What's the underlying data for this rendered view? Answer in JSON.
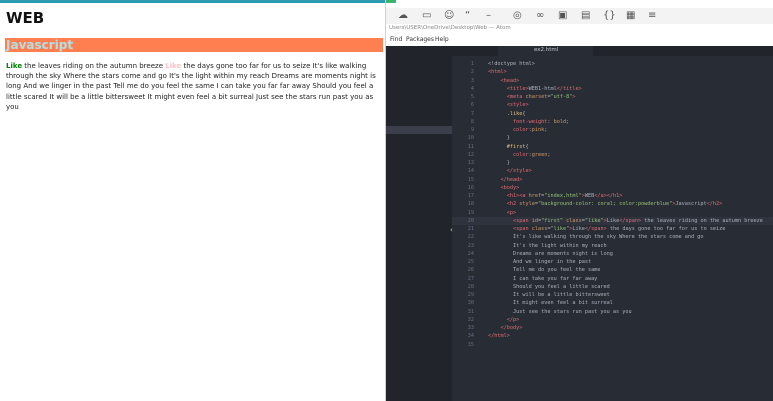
{
  "browser": {
    "h1": "WEB",
    "h2": "Javascript",
    "paragraph": {
      "first_like": "Like",
      "text1": " the leaves riding on the autumn breeze ",
      "second_like": "Like",
      "text2": " the days gone too far for us to seize It's like walking through the sky Where the stars come and go It's the light within my reach Dreams are moments night is long And we linger in the past Tell me do you feel the same I can take you far far away Should you feel a little scared It will be a little bittersweet It might even feel a bit surreal Just see the stars run past you as you"
    }
  },
  "toolbar": {
    "icons": [
      "cloud-icon",
      "video-icon",
      "emoji-icon",
      "quote-icon",
      "font-size-icon",
      "location-icon",
      "link-icon",
      "media-icon",
      "file-icon",
      "braces-icon",
      "table-icon",
      "list-icon"
    ]
  },
  "window": {
    "title_path": "Users\\USER\\OneDrive\\Desktop\\Web — Atom",
    "menu": [
      "Find",
      "Packages",
      "Help"
    ],
    "tab": "ex2.html"
  },
  "editor": {
    "lines": [
      {
        "n": "1",
        "html": "<span class='txt'>&lt;!doctype html&gt;</span>"
      },
      {
        "n": "2",
        "html": "<span class='tag'>&lt;html&gt;</span>"
      },
      {
        "n": "3",
        "html": "    <span class='tag'>&lt;head&gt;</span>"
      },
      {
        "n": "4",
        "html": "      <span class='tag'>&lt;title&gt;</span>WEB1-html<span class='tag'>&lt;/title&gt;</span>"
      },
      {
        "n": "5",
        "html": "      <span class='tag'>&lt;meta</span> <span class='attr'>charset</span>=<span class='str'>\"utf-8\"</span><span class='tag'>&gt;</span>"
      },
      {
        "n": "6",
        "html": "      <span class='tag'>&lt;style&gt;</span>"
      },
      {
        "n": "7",
        "html": "      <span class='sel'>.like</span>{"
      },
      {
        "n": "8",
        "html": "        <span class='prop'>font-weight</span>: <span class='val'>bold</span>;"
      },
      {
        "n": "9",
        "html": "        <span class='prop'>color</span>:<span class='val'>pink</span>;"
      },
      {
        "n": "10",
        "html": "      }"
      },
      {
        "n": "11",
        "html": "      <span class='sel'>#first</span>{"
      },
      {
        "n": "12",
        "html": "        <span class='prop'>color</span>:<span class='val'>green</span>;"
      },
      {
        "n": "13",
        "html": "      }"
      },
      {
        "n": "14",
        "html": "      <span class='tag'>&lt;/style&gt;</span>"
      },
      {
        "n": "15",
        "html": "    <span class='tag'>&lt;/head&gt;</span>"
      },
      {
        "n": "16",
        "html": "    <span class='tag'>&lt;body&gt;</span>"
      },
      {
        "n": "17",
        "html": "      <span class='tag'>&lt;h1&gt;&lt;a</span> <span class='attr'>href</span>=<span class='str'>\"index,html\"</span><span class='tag'>&gt;</span>WEB<span class='tag'>&lt;/a&gt;&lt;/h1&gt;</span>"
      },
      {
        "n": "18",
        "html": "      <span class='tag'>&lt;h2</span> <span class='attr'>style</span>=<span class='str'>\"background-color: coral; color:powderblue\"</span><span class='tag'>&gt;</span>Javascript<span class='tag'>&lt;/h2&gt;</span>"
      },
      {
        "n": "19",
        "html": "      <span class='tag'>&lt;p&gt;</span>"
      },
      {
        "n": "20",
        "html": "        <span class='tag'>&lt;span</span> <span class='attr'>id</span>=<span class='str'>\"first\"</span> <span class='attr'>class</span>=<span class='str'>\"like\"</span><span class='tag'>&gt;</span>Like<span class='tag'>&lt;/span&gt;</span> the leaves riding on the autumn breeze"
      },
      {
        "n": "21",
        "html": "        <span class='tag'>&lt;span</span> <span class='attr'>class</span>=<span class='str'>\"like\"</span><span class='tag'>&gt;</span>Like<span class='tag'>&lt;/span&gt;</span> the days gone too far for us to seize"
      },
      {
        "n": "22",
        "html": "        It's like walking through the sky Where the stars come and go"
      },
      {
        "n": "23",
        "html": "        It's the light within my reach"
      },
      {
        "n": "24",
        "html": "        Dreams are moments night is long"
      },
      {
        "n": "25",
        "html": "        And we linger in the past"
      },
      {
        "n": "26",
        "html": "        Tell me do you feel the same"
      },
      {
        "n": "27",
        "html": "        I can take you far far away"
      },
      {
        "n": "28",
        "html": "        Should you feel a little scared"
      },
      {
        "n": "29",
        "html": "        It will be a little bittersweet"
      },
      {
        "n": "30",
        "html": "        It might even feel a bit surreal"
      },
      {
        "n": "31",
        "html": "        Just see the stars run past you as you"
      },
      {
        "n": "32",
        "html": "      <span class='tag'>&lt;/p&gt;</span>"
      },
      {
        "n": "33",
        "html": "    <span class='tag'>&lt;/body&gt;</span>"
      },
      {
        "n": "34",
        "html": "<span class='tag'>&lt;/html&gt;</span>"
      },
      {
        "n": "35",
        "html": ""
      }
    ],
    "current_line": "20"
  }
}
